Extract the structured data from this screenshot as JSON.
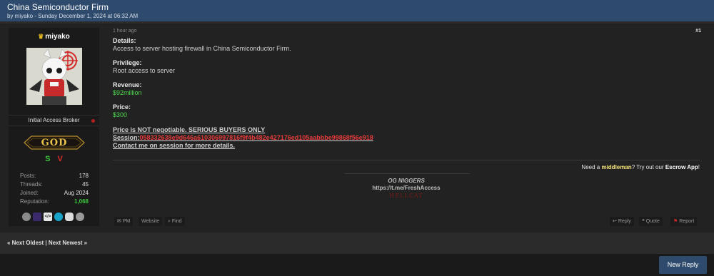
{
  "thread": {
    "title": "China Semiconductor Firm",
    "byline": "by miyako - Sunday December 1, 2024 at 06:32 AM"
  },
  "user": {
    "name": "miyako",
    "title": "Initial Access Broker",
    "rank_badge": "GOD",
    "badge_s": "S",
    "badge_v": "V",
    "stats": [
      {
        "label": "Posts:",
        "value": "178"
      },
      {
        "label": "Threads:",
        "value": "45"
      },
      {
        "label": "Joined:",
        "value": "Aug 2024"
      },
      {
        "label": "Reputation:",
        "value": "1,068"
      }
    ],
    "award_icons": [
      "ninja-icon",
      "crypto-icon",
      "code-icon",
      "eye-icon",
      "gamepad-icon",
      "chat-icon"
    ]
  },
  "post": {
    "time": "1 hour ago",
    "number": "#1",
    "details_label": "Details:",
    "details": "Access to server hosting firewall in China Semiconductor Firm.",
    "privilege_label": "Privilege:",
    "privilege": "Root access to server",
    "revenue_label": "Revenue:",
    "revenue": "$92million",
    "price_label": "Price:",
    "price": "$300",
    "notice": "Price is NOT negotiable. SERIOUS BUYERS ONLY",
    "session_label": "Session:",
    "session_id": "058332638e9d646a610306997816f9f4b482e427176ed105aabbbe99868f56e918",
    "contact": "Contact me on session for more details."
  },
  "middleman": {
    "prefix": "Need a ",
    "highlight": "middleman",
    "middle": "? Try out our ",
    "escrow": "Escrow App",
    "suffix": "!"
  },
  "signature": {
    "title": "OG NIGGERS",
    "link": "https://t.me/FreshAccess",
    "tag": "HELLCAT"
  },
  "actions": {
    "pm": "PM",
    "website": "Website",
    "find": "Find",
    "reply": "Reply",
    "quote": "Quote",
    "report": "Report"
  },
  "pager": {
    "text": "« Next Oldest | Next Newest »"
  },
  "footer": {
    "new_reply": "New Reply"
  },
  "colors": {
    "header_bg": "#2e4a6c",
    "accent_green": "#4bd84b",
    "accent_red": "#e53b3b",
    "highlight_yellow": "#f4e27a"
  }
}
